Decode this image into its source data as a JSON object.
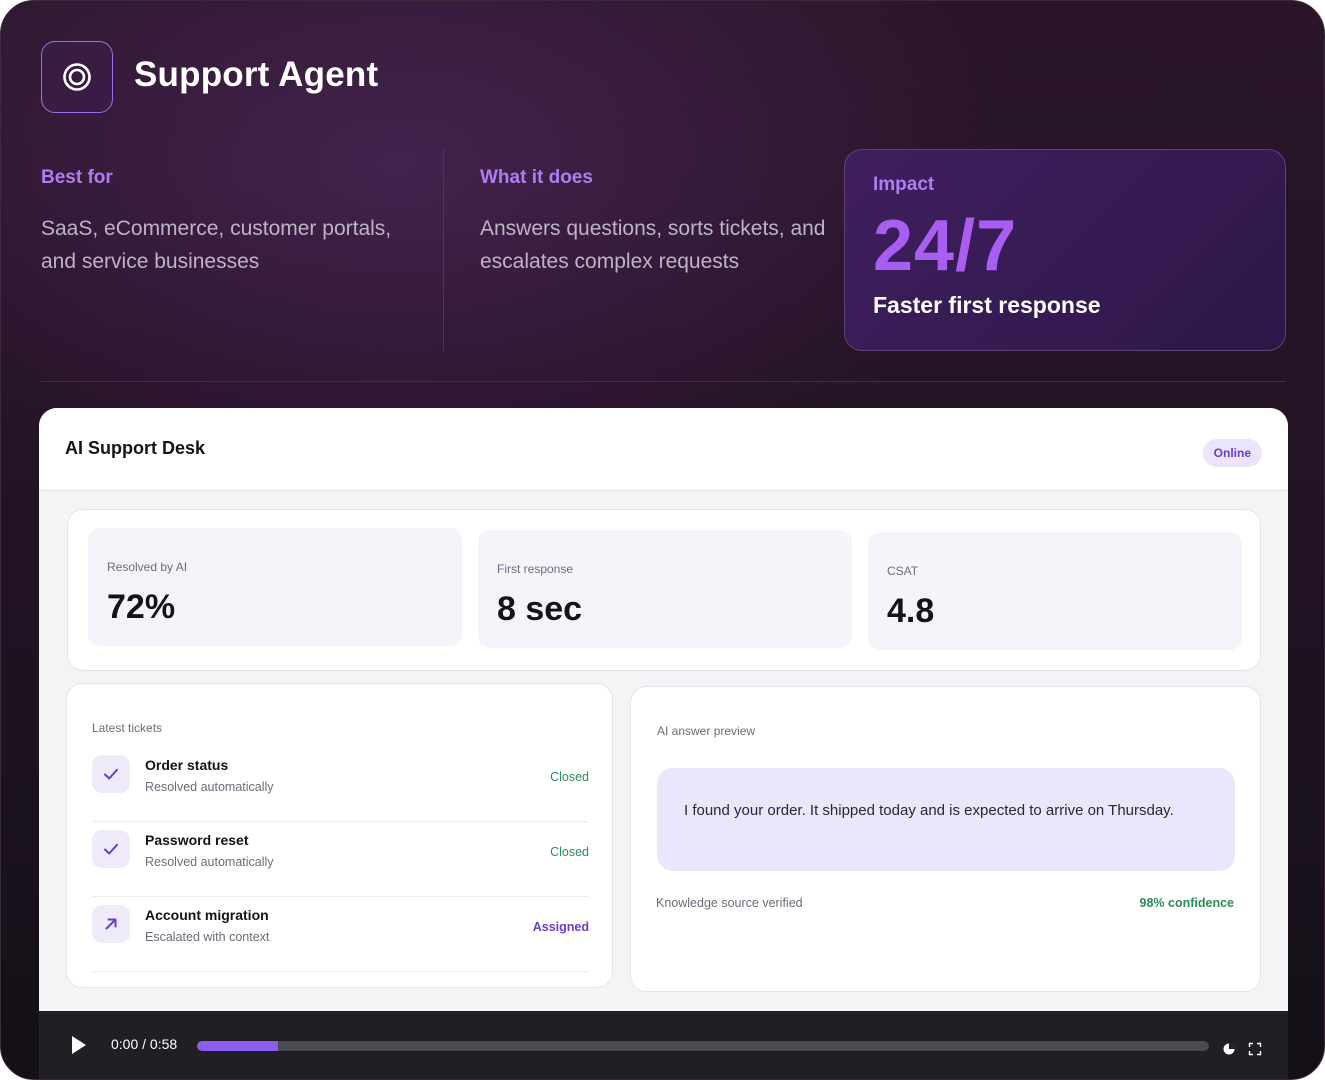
{
  "header": {
    "title": "Support Agent",
    "logo_icon": "target-ring-icon"
  },
  "info": {
    "best_for": {
      "heading": "Best for",
      "text": "SaaS, eCommerce, customer portals, and service businesses"
    },
    "what_it_does": {
      "heading": "What it does",
      "text": "Answers questions, sorts tickets, and escalates complex requests"
    },
    "impact": {
      "heading": "Impact",
      "value": "24/7",
      "caption": "Faster first response"
    }
  },
  "desk": {
    "title": "AI Support Desk",
    "status_badge": "Online",
    "stats": [
      {
        "label": "Resolved by AI",
        "value": "72%"
      },
      {
        "label": "First response",
        "value": "8 sec"
      },
      {
        "label": "CSAT",
        "value": "4.8"
      }
    ],
    "tickets": {
      "heading": "Latest tickets",
      "items": [
        {
          "name": "Order status",
          "detail": "Resolved automatically",
          "status": "Closed",
          "icon": "check-icon"
        },
        {
          "name": "Password reset",
          "detail": "Resolved automatically",
          "status": "Closed",
          "icon": "check-icon"
        },
        {
          "name": "Account migration",
          "detail": "Escalated with context",
          "status": "Assigned",
          "icon": "arrow-up-right-icon"
        }
      ]
    },
    "preview": {
      "heading": "AI answer preview",
      "message": "I found your order. It shipped today and is expected to arrive on Thursday.",
      "source": "Knowledge source verified",
      "confidence": "98% confidence"
    }
  },
  "video": {
    "time": "0:00 / 0:58",
    "progress": 0.08
  },
  "colors": {
    "accent": "#a85ef0",
    "accent_label": "#b07cf2",
    "success": "#2f8a5a",
    "assigned": "#6a3dc8"
  }
}
